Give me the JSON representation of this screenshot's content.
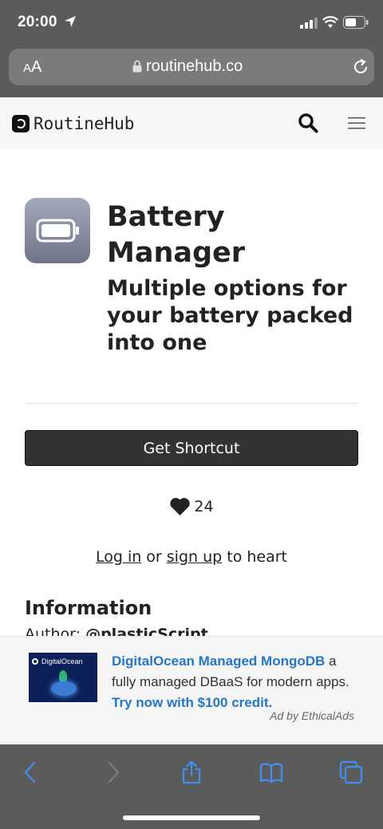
{
  "status_bar": {
    "time": "20:00",
    "icons": [
      "location-arrow-icon",
      "cellular-signal-icon",
      "wifi-icon",
      "battery-icon"
    ]
  },
  "browser": {
    "text_size_label_small": "A",
    "text_size_label_large": "A",
    "url": "routinehub.co"
  },
  "site_nav": {
    "logo_text": "RoutineHub"
  },
  "shortcut": {
    "title": "Battery Manager",
    "subtitle": "Multiple options for your battery packed into one",
    "get_button_label": "Get Shortcut",
    "heart_count": "24",
    "login_link": "Log in",
    "or_text": " or ",
    "signup_link": "sign up",
    "to_heart_text": " to heart"
  },
  "information": {
    "heading": "Information",
    "author_label": "Author: ",
    "author_value": "@plasticScript"
  },
  "ad": {
    "image_label": "DigitalOcean",
    "headline": "DigitalOcean Managed MongoDB",
    "body": " a fully managed DBaaS for modern apps. ",
    "cta": "Try now with $100 credit.",
    "attribution": "Ad by EthicalAds"
  },
  "colors": {
    "chrome": "#5b5b5b",
    "link_blue": "#2676c8",
    "toolbar_icon_blue": "#3f8ef0",
    "button_dark": "#333333"
  }
}
